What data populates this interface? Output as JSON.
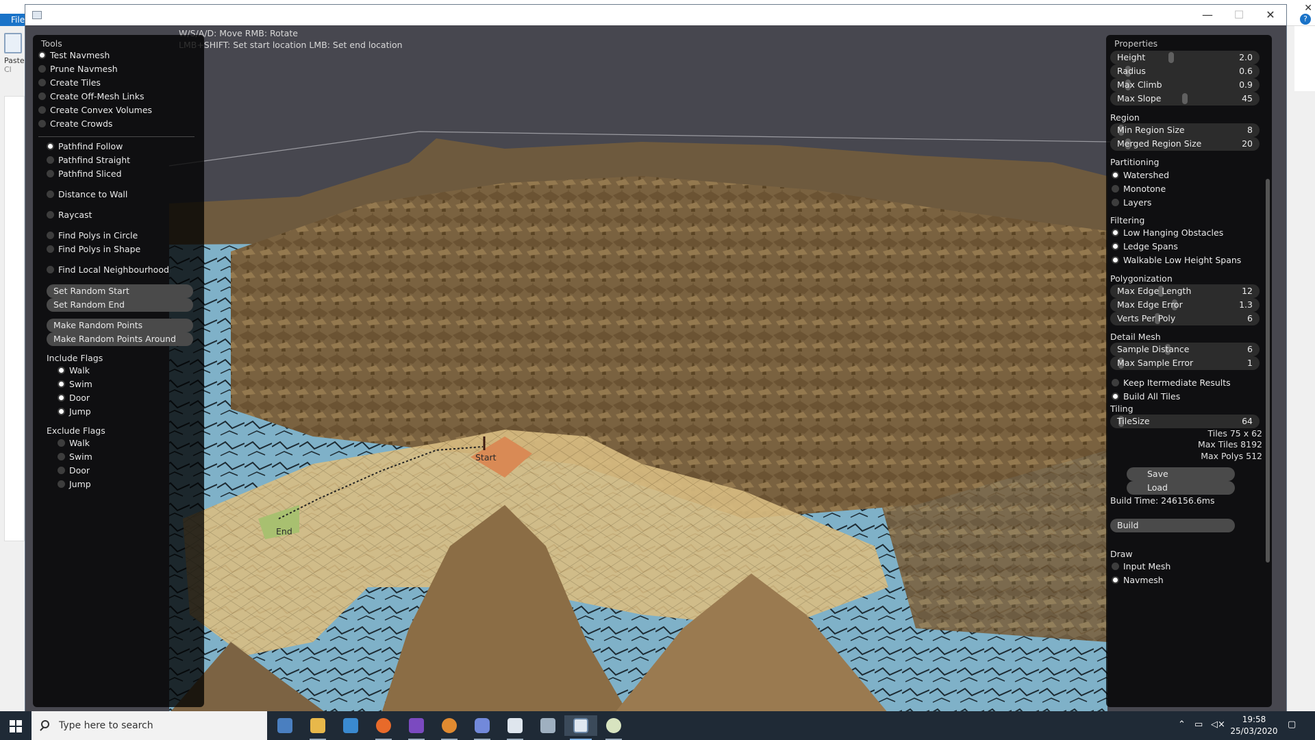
{
  "background_app": {
    "file_tab": "File",
    "paste_label": "Paste",
    "clipboard_label": "Cl"
  },
  "window": {
    "minimize": "—",
    "maximize": "☐",
    "close": "✕"
  },
  "hints": {
    "line1": "W/S/A/D: Move  RMB: Rotate",
    "line2": "LMB+SHIFT: Set start location  LMB: Set end location"
  },
  "tools": {
    "title": "Tools",
    "tool_modes": [
      {
        "label": "Test Navmesh",
        "selected": true
      },
      {
        "label": "Prune Navmesh",
        "selected": false
      },
      {
        "label": "Create Tiles",
        "selected": false
      },
      {
        "label": "Create Off-Mesh Links",
        "selected": false
      },
      {
        "label": "Create Convex Volumes",
        "selected": false
      },
      {
        "label": "Create Crowds",
        "selected": false
      }
    ],
    "path_modes": [
      {
        "label": "Pathfind Follow",
        "selected": true
      },
      {
        "label": "Pathfind Straight",
        "selected": false
      },
      {
        "label": "Pathfind Sliced",
        "selected": false
      },
      {
        "label": "Distance to Wall",
        "selected": false
      },
      {
        "label": "Raycast",
        "selected": false
      },
      {
        "label": "Find Polys in Circle",
        "selected": false
      },
      {
        "label": "Find Polys in Shape",
        "selected": false
      },
      {
        "label": "Find Local Neighbourhood",
        "selected": false
      }
    ],
    "buttons": {
      "set_random_start": "Set Random Start",
      "set_random_end": "Set Random End",
      "make_random_points": "Make Random Points",
      "make_random_points_around": "Make Random Points Around"
    },
    "include_flags": {
      "title": "Include Flags",
      "items": [
        {
          "label": "Walk",
          "checked": true
        },
        {
          "label": "Swim",
          "checked": true
        },
        {
          "label": "Door",
          "checked": true
        },
        {
          "label": "Jump",
          "checked": true
        }
      ]
    },
    "exclude_flags": {
      "title": "Exclude Flags",
      "items": [
        {
          "label": "Walk",
          "checked": false
        },
        {
          "label": "Swim",
          "checked": false
        },
        {
          "label": "Door",
          "checked": false
        },
        {
          "label": "Jump",
          "checked": false
        }
      ]
    }
  },
  "properties": {
    "title": "Properties",
    "agent": [
      {
        "label": "Height",
        "value": "2.0",
        "level": 0.4
      },
      {
        "label": "Radius",
        "value": "0.6",
        "level": 0.1
      },
      {
        "label": "Max Climb",
        "value": "0.9",
        "level": 0.1
      },
      {
        "label": "Max Slope",
        "value": "45",
        "level": 0.5
      }
    ],
    "region": {
      "title": "Region",
      "sliders": [
        {
          "label": "Min Region Size",
          "value": "8",
          "level": 0.05
        },
        {
          "label": "Merged Region Size",
          "value": "20",
          "level": 0.1
        }
      ]
    },
    "partitioning": {
      "title": "Partitioning",
      "options": [
        {
          "label": "Watershed",
          "selected": true
        },
        {
          "label": "Monotone",
          "selected": false
        },
        {
          "label": "Layers",
          "selected": false
        }
      ]
    },
    "filtering": {
      "title": "Filtering",
      "options": [
        {
          "label": "Low Hanging Obstacles",
          "checked": true
        },
        {
          "label": "Ledge Spans",
          "checked": true
        },
        {
          "label": "Walkable Low Height Spans",
          "checked": true
        }
      ]
    },
    "polygonization": {
      "title": "Polygonization",
      "sliders": [
        {
          "label": "Max Edge Length",
          "value": "12",
          "level": 0.35
        },
        {
          "label": "Max Edge Error",
          "value": "1.3",
          "level": 0.4
        },
        {
          "label": "Verts Per Poly",
          "value": "6",
          "level": 0.3
        }
      ]
    },
    "detail_mesh": {
      "title": "Detail Mesh",
      "sliders": [
        {
          "label": "Sample Distance",
          "value": "6",
          "level": 0.35
        },
        {
          "label": "Max Sample Error",
          "value": "1",
          "level": 0.05
        }
      ],
      "options": [
        {
          "label": "Keep Itermediate Results",
          "checked": false
        },
        {
          "label": "Build All Tiles",
          "checked": true
        }
      ]
    },
    "tiling": {
      "title": "Tiling",
      "slider": {
        "label": "TileSize",
        "value": "64",
        "level": 0.05
      },
      "tiles": "Tiles  75 x 62",
      "max_tiles": "Max Tiles  8192",
      "max_polys": "Max Polys  512"
    },
    "save": "Save",
    "load": "Load",
    "build_time": "Build Time: 246156.6ms",
    "build": "Build",
    "draw": {
      "title": "Draw",
      "options": [
        {
          "label": "Input Mesh",
          "selected": false
        },
        {
          "label": "Navmesh",
          "selected": true
        }
      ]
    }
  },
  "scene_labels": {
    "start": "Start",
    "end": "End"
  },
  "taskbar": {
    "search_placeholder": "Type here to search",
    "time": "19:58",
    "date": "25/03/2020",
    "apps": [
      "people-icon",
      "file-explorer-icon",
      "store-icon",
      "firefox-icon",
      "visual-studio-icon",
      "blender-icon",
      "discord-icon",
      "app-window-icon",
      "devices-icon",
      "recast-demo-icon",
      "paint-icon"
    ]
  }
}
